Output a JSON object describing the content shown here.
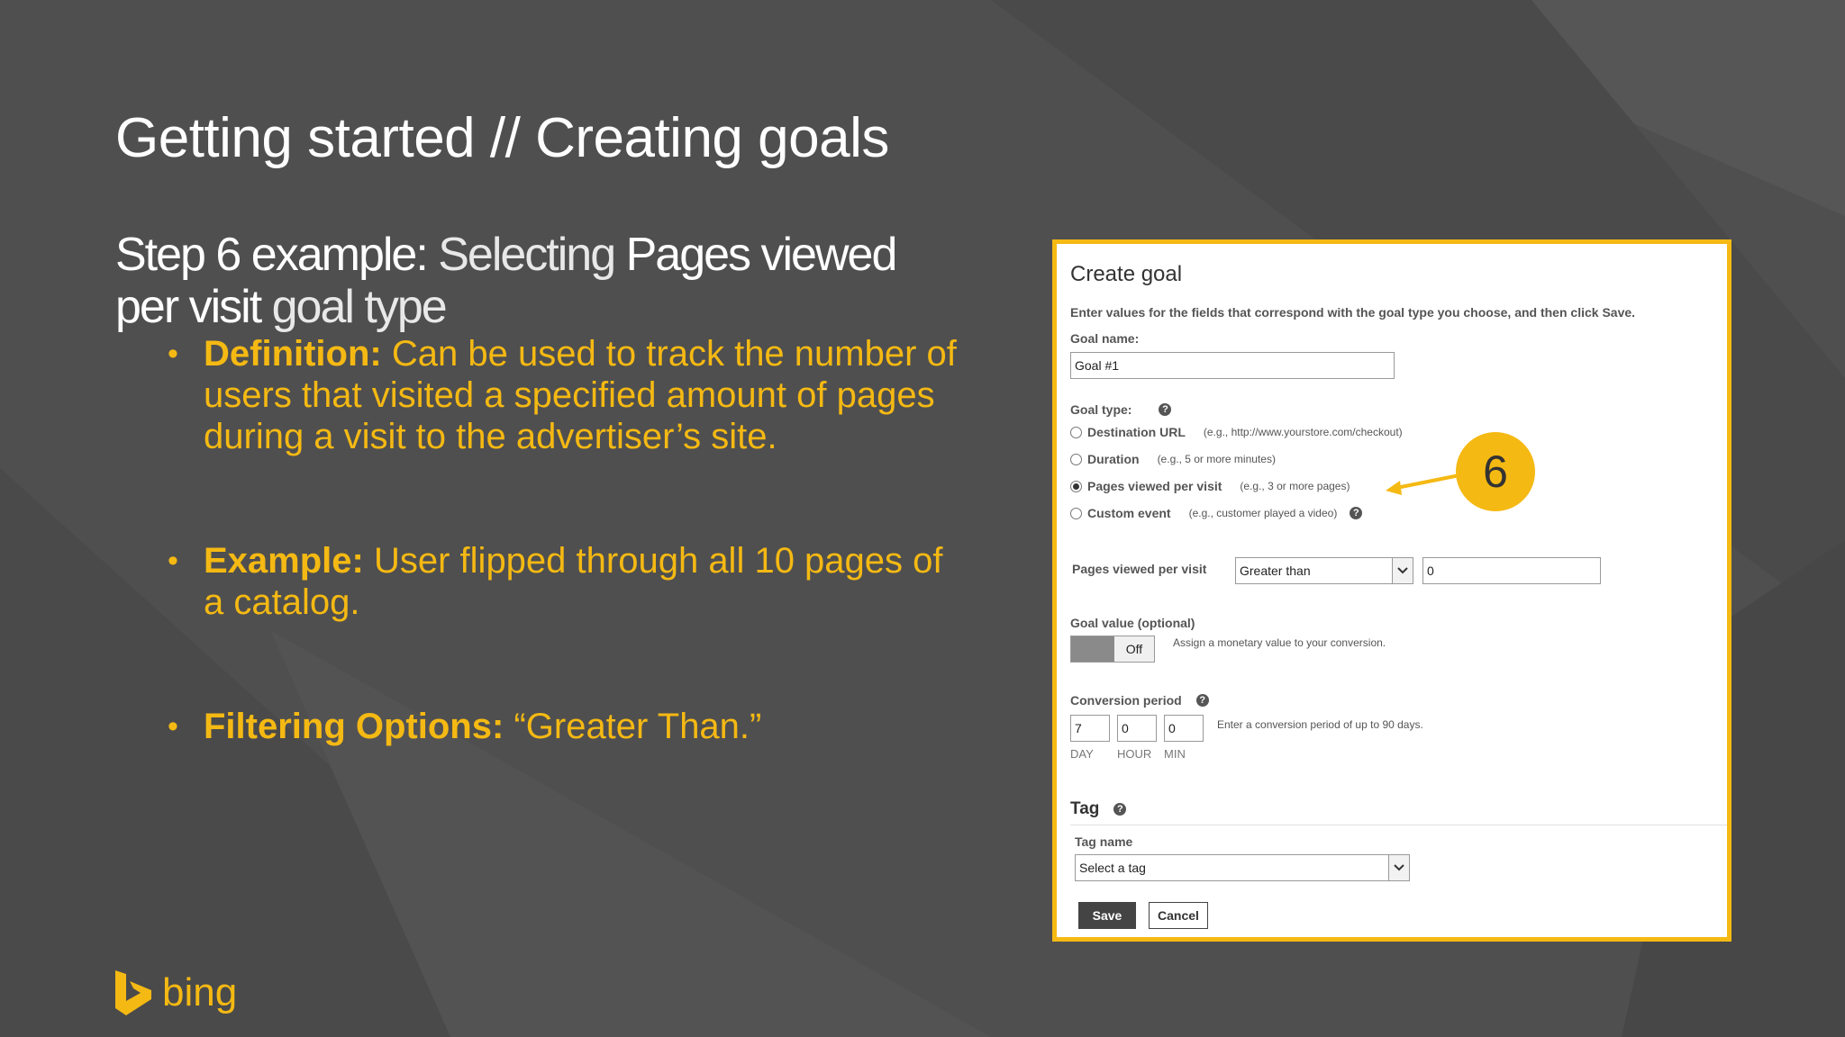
{
  "slide": {
    "title": "Getting started // Creating goals",
    "subtitle_part1": "Step 6 example:",
    "subtitle_part2": "Selecting",
    "subtitle_part3": "Pages viewed per visit",
    "subtitle_part4": "goal type"
  },
  "bullets": [
    {
      "label": "Definition:",
      "text": "Can be used to track the number of users that visited a specified amount of pages during a visit to the advertiser’s site."
    },
    {
      "label": "Example:",
      "text": "User flipped through all 10 pages of a catalog."
    },
    {
      "label": "Filtering Options:",
      "text": "“Greater Than.”"
    }
  ],
  "logo": {
    "word": "bing",
    "icon": "bing-b-icon"
  },
  "callout": {
    "number": "6"
  },
  "dialog": {
    "title": "Create goal",
    "instructions": "Enter values for the fields that correspond with the goal type you choose, and then click Save.",
    "goal_name_label": "Goal name:",
    "goal_name_value": "Goal #1",
    "goal_type_label": "Goal type:",
    "goal_types": [
      {
        "label": "Destination URL",
        "hint": "(e.g., http://www.yourstore.com/checkout)",
        "selected": false
      },
      {
        "label": "Duration",
        "hint": "(e.g., 5 or more minutes)",
        "selected": false
      },
      {
        "label": "Pages viewed per visit",
        "hint": "(e.g., 3 or more pages)",
        "selected": true
      },
      {
        "label": "Custom event",
        "hint": "(e.g., customer played a video)",
        "selected": false
      }
    ],
    "pages_label": "Pages viewed per visit",
    "pages_operator": "Greater than",
    "pages_value": "0",
    "goal_value_label": "Goal value (optional)",
    "goal_value_toggle": "Off",
    "goal_value_hint": "Assign a monetary value to your conversion.",
    "conversion_label": "Conversion period",
    "conversion_day": "7",
    "conversion_hour": "0",
    "conversion_min": "0",
    "conversion_hint": "Enter a conversion period of up to 90 days.",
    "unit_day": "DAY",
    "unit_hour": "HOUR",
    "unit_min": "MIN",
    "tag_heading": "Tag",
    "tag_name_label": "Tag name",
    "tag_select": "Select a tag",
    "save_label": "Save",
    "cancel_label": "Cancel",
    "help_glyph": "?"
  },
  "colors": {
    "accent": "#f5b913",
    "background": "#4f4f4f"
  }
}
